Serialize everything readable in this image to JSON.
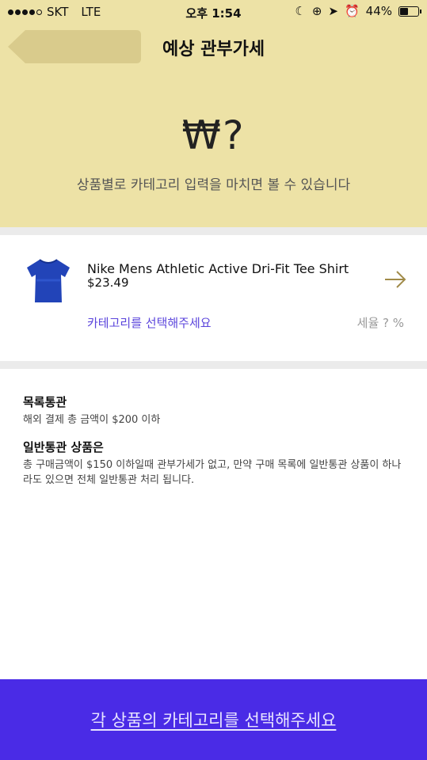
{
  "status_bar": {
    "carrier": "SKT",
    "network": "LTE",
    "time": "오후 1:54",
    "battery": "44%"
  },
  "header": {
    "title": "예상 관부가세",
    "price": "₩?",
    "subtitle": "상품별로 카테고리 입력을 마치면 볼 수 있습니다"
  },
  "product": {
    "name": "Nike Mens Athletic Active Dri-Fit Tee Shirt",
    "price": "$23.49",
    "category_prompt": "카테고리를 선택해주세요",
    "tax_rate": "세율 ? %"
  },
  "info": {
    "list_clearance_title": "목록통관",
    "list_clearance_text": "해외 결제 총 금액이 $200 이하",
    "general_clearance_title": "일반통관 상품은",
    "general_clearance_text": "총 구매금액이  $150 이하일때 관부가세가 없고, 만약 구매 목록에 일반통관 상품이 하나라도 있으면 전체 일반통관 처리 됩니다."
  },
  "bottom_button": {
    "label": "각 상품의 카테고리를 선택해주세요"
  },
  "colors": {
    "header_bg": "#ede2a6",
    "accent": "#5b45dc",
    "bottom_bar": "#4a2be6"
  }
}
